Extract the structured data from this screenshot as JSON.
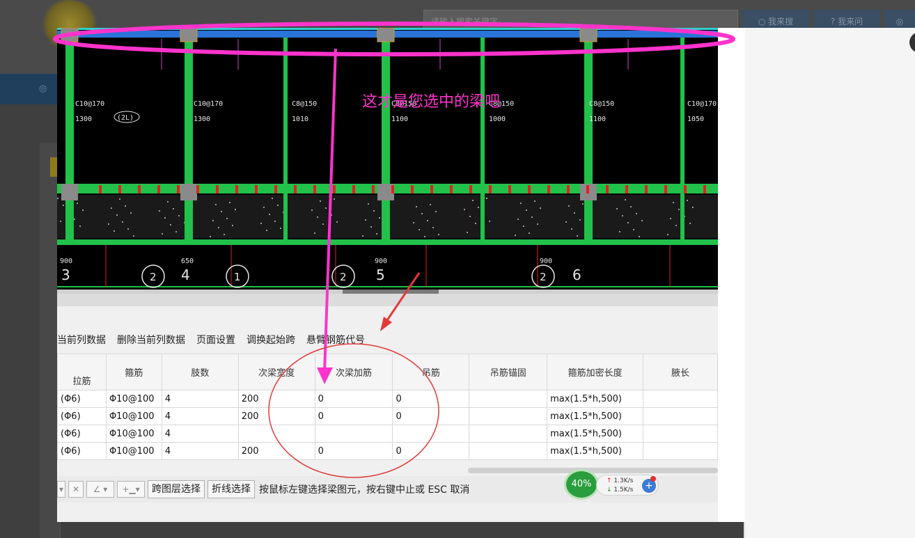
{
  "background": {
    "search_placeholder": "请输入搜索关键字",
    "search_button": "我来搜",
    "ask_button": "我来问",
    "close_glyph": "✕"
  },
  "annotation": {
    "label": "这才是您选中的梁吧",
    "ellipse_color": "#ff33cc",
    "arrow_color": "#ff33cc",
    "circle_color": "#e23a3a"
  },
  "cad": {
    "stirrup_labels": [
      "C10@170",
      "C10@170",
      "C8@150",
      "C8@150",
      "C8@150",
      "C8@150",
      "C10@170"
    ],
    "length_labels": [
      "1300",
      "1300",
      "1010",
      "1100",
      "1000",
      "1100",
      "1050"
    ],
    "axis_labels": [
      "3",
      "4",
      "5",
      "6"
    ],
    "bottom_labels": [
      "900",
      "650",
      "900",
      "900"
    ],
    "circle_tags": [
      "1",
      "2",
      "2",
      "2"
    ],
    "beam_tag": "(2L)"
  },
  "menu": {
    "items": [
      "当前列数据",
      "删除当前列数据",
      "页面设置",
      "调换起始跨",
      "悬臂钢筋代号"
    ]
  },
  "grid": {
    "headers": [
      "拉筋",
      "箍筋",
      "肢数",
      "次梁宽度",
      "次梁加筋",
      "吊筋",
      "吊筋锚固",
      "箍筋加密长度",
      "腋长"
    ],
    "rows": [
      [
        "(Φ6)",
        "Φ10@100",
        "4",
        "200",
        "0",
        "0",
        "",
        "max(1.5*h,500)",
        ""
      ],
      [
        "(Φ6)",
        "Φ10@100",
        "4",
        "200",
        "0",
        "0",
        "",
        "max(1.5*h,500)",
        ""
      ],
      [
        "(Φ6)",
        "Φ10@100",
        "4",
        "",
        "",
        "",
        "",
        "max(1.5*h,500)",
        ""
      ],
      [
        "(Φ6)",
        "Φ10@100",
        "4",
        "200",
        "0",
        "0",
        "",
        "max(1.5*h,500)",
        ""
      ]
    ]
  },
  "toolbar": {
    "layer_select": "跨图层选择",
    "polyline_select": "折线选择",
    "hint": "按鼠标左键选择梁图元，按右键中止或 ESC 取消"
  },
  "network": {
    "percent": "40%",
    "up": "1.3K/s",
    "down": "1.5K/s",
    "plus": "+"
  }
}
